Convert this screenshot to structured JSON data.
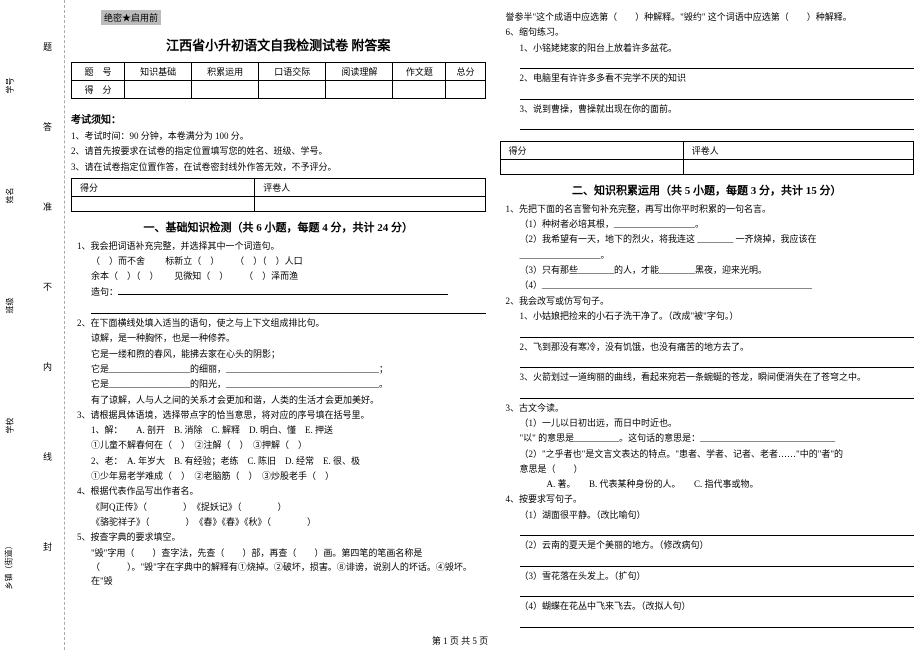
{
  "margin": {
    "field1": "乡镇（街道）",
    "field2": "学校",
    "field3": "班级",
    "field4": "姓名",
    "field5": "学号",
    "fold_labels": [
      "封",
      "线",
      "内",
      "不",
      "准",
      "答",
      "题"
    ]
  },
  "header": {
    "secret": "绝密★启用前",
    "title": "江西省小升初语文自我检测试卷 附答案"
  },
  "score_table": {
    "row1": [
      "题　号",
      "知识基础",
      "积累运用",
      "口语交际",
      "阅读理解",
      "作文题",
      "总分"
    ],
    "row2": [
      "得　分",
      "",
      "",
      "",
      "",
      "",
      ""
    ]
  },
  "exam_notice": {
    "heading": "考试须知：",
    "items": [
      "1、考试时间：90 分钟，本卷满分为 100 分。",
      "2、请首先按要求在试卷的指定位置填写您的姓名、班级、学号。",
      "3、请在试卷指定位置作答，在试卷密封线外作答无效，不予评分。"
    ]
  },
  "scorer_box": {
    "c1": "得分",
    "c2": "评卷人"
  },
  "section1": {
    "title": "一、基础知识检测（共 6 小题，每题 4 分，共计 24 分）",
    "q1": "1、我会把词语补充完整，并选择其中一个词造句。",
    "q1_words": [
      "（　）而不舍",
      "标新立（　）",
      "（　）（　）人口",
      "余本（　）（　）",
      "见微知（　）",
      "（　）泽而渔"
    ],
    "q1_make": "造句：",
    "q2": "2、在下面横线处填入适当的语句，使之与上下文组成排比句。",
    "q2_lines": [
      "谅解，是一种胸怀，也是一种修养。",
      "它是一缕和煦的春风，能拂去家在心头的阴影；",
      "它是__________________的细丽，__________________________________；",
      "它是__________________的阳光，__________________________________。",
      "有了谅解，人与人之间的关系才会更加和谐，人类的生活才会更加美好。"
    ],
    "q3": "3、请根据具体语境，选择带点字的恰当意思，将对应的序号填在括号里。",
    "q3_line1": "1、解：　　A. 剖开　B. 消除　C. 解释　D. 明白、懂　E. 押送",
    "q3_sub1": "①儿童不解春何在（　）　②注解（　）　③押解（　）",
    "q3_line2": "2、老：　A. 年岁大　B. 有经验；老练　C. 陈旧　D. 经常　E. 很、极",
    "q3_sub2": "①少年易老学难成（　）　②老脑筋（　）　③炒股老手（　）",
    "q4": "4、根据代表作品写出作者名。",
    "q4_lines": [
      "《阿Q正传》（　　　　）　《捉妖记》（　　　　）",
      "《骆驼祥子》（　　　　）　《春》《春》《秋》（　　　　）"
    ],
    "q5": "5、按查字典的要求填空。",
    "q5_text": "\"毁\"字用（　　）查字法，先查（　　）部，再查（　　）画。第四笔的笔画名称是（　　　）。\"毁\"字在字典中的解释有①烧掉。②破坏，损害。⑧诽谤，说别人的坏话。④毁坏。在\"毁"
  },
  "col2": {
    "cont": "誉参半\"这个成语中应选第（　　）种解释。\"毁约\" 这个词语中应选第（　　）种解释。",
    "q6": "6、缩句练习。",
    "q6_items": [
      "1、小铭姥姥家的阳台上放着许多盆花。",
      "2、电脑里有许许多多看不完学不厌的知识",
      "3、说到曹操，曹操就出现在你的面前。"
    ],
    "section2_title": "二、知识积累运用（共 5 小题，每题 3 分，共计 15 分）",
    "s2_q1": "1、先把下面的名言警句补充完整，再写出你平时积累的一句名言。",
    "s2_q1_items": [
      "（1）种树者必培其根，__________________。",
      "（2）我希望有一天，地下的烈火，将我连这 ________ 一齐烧掉，我应该在",
      "__________________。",
      "（3）只有那些________的人，才能________黑夜，迎来光明。",
      "（4）____________________________________________________________"
    ],
    "s2_q2": "2、我会改写或仿写句子。",
    "s2_q2_items": [
      "1、小姑娘把捡来的小石子洗干净了。（改成\"被\"字句。）",
      "2、飞到那没有寒冷，没有饥饿，也没有痛苦的地方去了。",
      "3、火箭划过一道绚丽的曲线，看起来宛若一条蜿蜒的苍龙，瞬间便消失在了苍穹之中。"
    ],
    "s2_q3": "3、古文今读。",
    "s2_q3_items": [
      "（1）一儿以日初出远，而日中时近也。",
      "\"以\" 的意思是__________。这句话的意思是：______________________________",
      "（2）\"之乎者也\"是文言文表达的特点。\"患者、学者、记者、老者……\"中的\"者\"的",
      "意思是（　　）",
      "　　　A. 著。　　B. 代表某种身份的人。　　C. 指代事或物。"
    ],
    "s2_q4": "4、按要求写句子。",
    "s2_q4_items": [
      "（1）湖面很平静。（改比喻句）",
      "（2）云南的夏天是个美丽的地方。（修改病句）",
      "（3）雪花落在头发上。（扩句）",
      "（4）蝴蝶在花丛中飞来飞去。（改拟人句）"
    ]
  },
  "footer": "第 1 页 共 5 页"
}
